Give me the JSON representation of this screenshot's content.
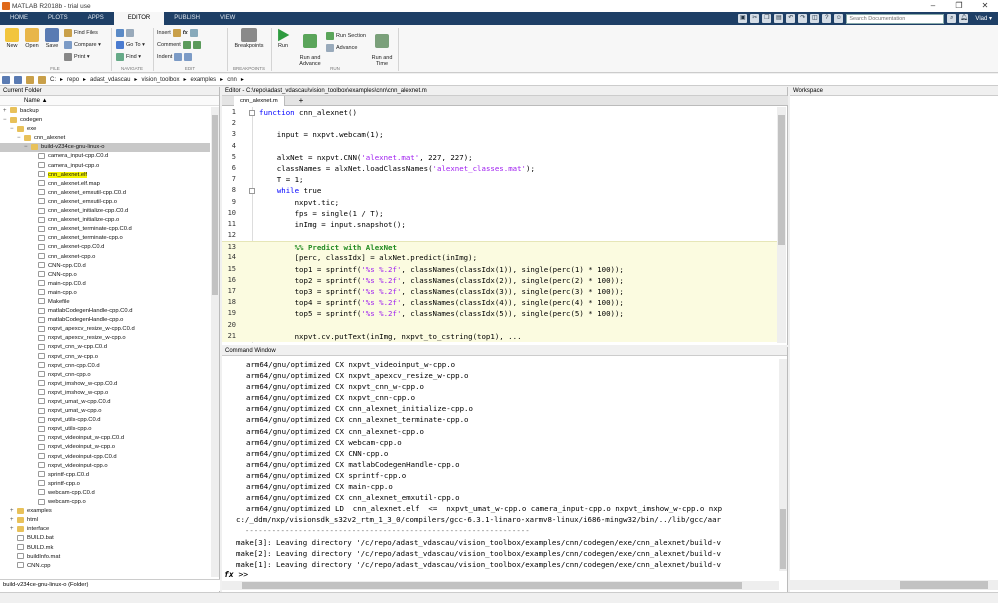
{
  "window": {
    "title": "MATLAB R2018b - trial use",
    "controls": [
      "–",
      "❐",
      "✕"
    ]
  },
  "tabs": [
    "HOME",
    "PLOTS",
    "APPS",
    "EDITOR",
    "PUBLISH",
    "VIEW"
  ],
  "active_tab": "EDITOR",
  "search": {
    "placeholder": "Search Documentation"
  },
  "user": "Vlad ▾",
  "ribbon": {
    "file": {
      "new": "New",
      "open": "Open",
      "save": "Save",
      "find_files": "Find Files",
      "compare": "Compare ▾",
      "print": "Print ▾",
      "section": "FILE"
    },
    "navigate": {
      "go_to": "Go To ▾",
      "find": "Find ▾",
      "section": "NAVIGATE"
    },
    "edit": {
      "insert": "Insert",
      "comment": "Comment",
      "indent": "Indent",
      "fx": "fx",
      "section": "EDIT"
    },
    "breakpoints": {
      "label": "Breakpoints",
      "section": "BREAKPOINTS"
    },
    "run": {
      "run": "Run",
      "run_advance": "Run and\nAdvance",
      "run_section": "Run Section",
      "advance": "Advance",
      "run_time": "Run and\nTime",
      "section": "RUN"
    }
  },
  "address": {
    "parts": [
      "C:",
      "repo",
      "adast_vdascau",
      "vision_toolbox",
      "examples",
      "cnn"
    ]
  },
  "current_folder": {
    "title": "Current Folder",
    "col_name": "Name ▲",
    "items": [
      {
        "label": "backup",
        "type": "folder",
        "level": 1,
        "exp": "+"
      },
      {
        "label": "codegen",
        "type": "folder",
        "level": 1,
        "exp": "−"
      },
      {
        "label": "exe",
        "type": "folder",
        "level": 2,
        "exp": "−"
      },
      {
        "label": "cnn_alexnet",
        "type": "folder",
        "level": 3,
        "exp": "−"
      },
      {
        "label": "build-v234ce-gnu-linux-o",
        "type": "folder",
        "level": 4,
        "exp": "−",
        "selected": true
      },
      {
        "label": "camera_input-cpp.C0.d",
        "type": "file",
        "level": 5
      },
      {
        "label": "camera_input-cpp.o",
        "type": "file",
        "level": 5
      },
      {
        "label": "cnn_alexnet.elf",
        "type": "file",
        "level": 5,
        "highlight": true
      },
      {
        "label": "cnn_alexnet.elf.map",
        "type": "file",
        "level": 5
      },
      {
        "label": "cnn_alexnet_emxutil-cpp.C0.d",
        "type": "file",
        "level": 5
      },
      {
        "label": "cnn_alexnet_emxutil-cpp.o",
        "type": "file",
        "level": 5
      },
      {
        "label": "cnn_alexnet_initialize-cpp.C0.d",
        "type": "file",
        "level": 5
      },
      {
        "label": "cnn_alexnet_initialize-cpp.o",
        "type": "file",
        "level": 5
      },
      {
        "label": "cnn_alexnet_terminate-cpp.C0.d",
        "type": "file",
        "level": 5
      },
      {
        "label": "cnn_alexnet_terminate-cpp.o",
        "type": "file",
        "level": 5
      },
      {
        "label": "cnn_alexnet-cpp.C0.d",
        "type": "file",
        "level": 5
      },
      {
        "label": "cnn_alexnet-cpp.o",
        "type": "file",
        "level": 5
      },
      {
        "label": "CNN-cpp.C0.d",
        "type": "file",
        "level": 5
      },
      {
        "label": "CNN-cpp.o",
        "type": "file",
        "level": 5
      },
      {
        "label": "main-cpp.C0.d",
        "type": "file",
        "level": 5
      },
      {
        "label": "main-cpp.o",
        "type": "file",
        "level": 5
      },
      {
        "label": "Makefile",
        "type": "file",
        "level": 5
      },
      {
        "label": "matlabCodegenHandle-cpp.C0.d",
        "type": "file",
        "level": 5
      },
      {
        "label": "matlabCodegenHandle-cpp.o",
        "type": "file",
        "level": 5
      },
      {
        "label": "nxpvt_apexcv_resize_w-cpp.C0.d",
        "type": "file",
        "level": 5
      },
      {
        "label": "nxpvt_apexcv_resize_w-cpp.o",
        "type": "file",
        "level": 5
      },
      {
        "label": "nxpvt_cnn_w-cpp.C0.d",
        "type": "file",
        "level": 5
      },
      {
        "label": "nxpvt_cnn_w-cpp.o",
        "type": "file",
        "level": 5
      },
      {
        "label": "nxpvt_cnn-cpp.C0.d",
        "type": "file",
        "level": 5
      },
      {
        "label": "nxpvt_cnn-cpp.o",
        "type": "file",
        "level": 5
      },
      {
        "label": "nxpvt_imshow_w-cpp.C0.d",
        "type": "file",
        "level": 5
      },
      {
        "label": "nxpvt_imshow_w-cpp.o",
        "type": "file",
        "level": 5
      },
      {
        "label": "nxpvt_umat_w-cpp.C0.d",
        "type": "file",
        "level": 5
      },
      {
        "label": "nxpvt_umat_w-cpp.o",
        "type": "file",
        "level": 5
      },
      {
        "label": "nxpvt_utils-cpp.C0.d",
        "type": "file",
        "level": 5
      },
      {
        "label": "nxpvt_utils-cpp.o",
        "type": "file",
        "level": 5
      },
      {
        "label": "nxpvt_videoinput_w-cpp.C0.d",
        "type": "file",
        "level": 5
      },
      {
        "label": "nxpvt_videoinput_w-cpp.o",
        "type": "file",
        "level": 5
      },
      {
        "label": "nxpvt_videoinput-cpp.C0.d",
        "type": "file",
        "level": 5
      },
      {
        "label": "nxpvt_videoinput-cpp.o",
        "type": "file",
        "level": 5
      },
      {
        "label": "sprintf-cpp.C0.d",
        "type": "file",
        "level": 5
      },
      {
        "label": "sprintf-cpp.o",
        "type": "file",
        "level": 5
      },
      {
        "label": "webcam-cpp.C0.d",
        "type": "file",
        "level": 5
      },
      {
        "label": "webcam-cpp.o",
        "type": "file",
        "level": 5
      },
      {
        "label": "examples",
        "type": "folder",
        "level": 2,
        "exp": "+"
      },
      {
        "label": "html",
        "type": "folder",
        "level": 2,
        "exp": "+"
      },
      {
        "label": "interface",
        "type": "folder",
        "level": 2,
        "exp": "+"
      },
      {
        "label": "BUILD.bat",
        "type": "file",
        "level": 2
      },
      {
        "label": "BUILD.mk",
        "type": "file",
        "level": 2
      },
      {
        "label": "buildInfo.mat",
        "type": "file",
        "level": 2
      },
      {
        "label": "CNN.cpp",
        "type": "file",
        "level": 2
      }
    ],
    "status": "build-v234ce-gnu-linux-o (Folder)"
  },
  "editor": {
    "title": "Editor - C:\\repo\\adast_vdascau\\vision_toolbox\\examples\\cnn\\cnn_alexnet.m",
    "tab": "cnn_alexnet.m",
    "lines": [
      {
        "n": "1",
        "html": "<span class=\"kw\">function</span> cnn_alexnet()"
      },
      {
        "n": "2",
        "html": ""
      },
      {
        "n": "3",
        "html": "    input = nxpvt.webcam(1);"
      },
      {
        "n": "4",
        "html": ""
      },
      {
        "n": "5",
        "html": "    alxNet = nxpvt.CNN(<span class=\"str\">'alexnet.mat'</span>, 227, 227);"
      },
      {
        "n": "6",
        "html": "    classNames = alxNet.loadClassNames(<span class=\"str\">'alexnet_classes.mat'</span>);"
      },
      {
        "n": "7",
        "html": "    T = 1;"
      },
      {
        "n": "8",
        "html": "    <span class=\"kw\">while</span> true"
      },
      {
        "n": "9",
        "html": "        nxpvt.tic;"
      },
      {
        "n": "10",
        "html": "        fps = single(1 / T);"
      },
      {
        "n": "11",
        "html": "        inImg = input.snapshot();"
      },
      {
        "n": "12",
        "html": ""
      },
      {
        "n": "13",
        "html": "        <span class=\"cmt\">%% Predict with AlexNet</span>",
        "cell": true
      },
      {
        "n": "14",
        "html": "        [perc, classIdx] = alxNet.predict(inImg);",
        "cell": true
      },
      {
        "n": "15",
        "html": "        top1 = sprintf(<span class=\"str\">'%s %.2f'</span>, classNames(classIdx(1)), single(perc(1) * 100));",
        "cell": true
      },
      {
        "n": "16",
        "html": "        top2 = sprintf(<span class=\"str\">'%s %.2f'</span>, classNames(classIdx(2)), single(perc(2) * 100));",
        "cell": true
      },
      {
        "n": "17",
        "html": "        top3 = sprintf(<span class=\"str\">'%s %.2f'</span>, classNames(classIdx(3)), single(perc(3) * 100));",
        "cell": true
      },
      {
        "n": "18",
        "html": "        top4 = sprintf(<span class=\"str\">'%s %.2f'</span>, classNames(classIdx(4)), single(perc(4) * 100));",
        "cell": true
      },
      {
        "n": "19",
        "html": "        top5 = sprintf(<span class=\"str\">'%s %.2f'</span>, classNames(classIdx(5)), single(perc(5) * 100));",
        "cell": true
      },
      {
        "n": "20",
        "html": "",
        "cell": true
      },
      {
        "n": "21",
        "html": "        nxpvt.cv.putText(inImg, nxpvt_to_cstring(top1), ...",
        "cell": true
      }
    ]
  },
  "command_window": {
    "title": "Command Window",
    "lines": [
      {
        "t": "arm64/gnu/optimized CX nxpvt_videoinput_w-cpp.o",
        "ind": true
      },
      {
        "t": "arm64/gnu/optimized CX nxpvt_apexcv_resize_w-cpp.o",
        "ind": true
      },
      {
        "t": "arm64/gnu/optimized CX nxpvt_cnn_w-cpp.o",
        "ind": true
      },
      {
        "t": "arm64/gnu/optimized CX nxpvt_cnn-cpp.o",
        "ind": true
      },
      {
        "t": "arm64/gnu/optimized CX cnn_alexnet_initialize-cpp.o",
        "ind": true
      },
      {
        "t": "arm64/gnu/optimized CX cnn_alexnet_terminate-cpp.o",
        "ind": true
      },
      {
        "t": "arm64/gnu/optimized CX cnn_alexnet-cpp.o",
        "ind": true
      },
      {
        "t": "arm64/gnu/optimized CX webcam-cpp.o",
        "ind": true
      },
      {
        "t": "arm64/gnu/optimized CX CNN-cpp.o",
        "ind": true
      },
      {
        "t": "arm64/gnu/optimized CX matlabCodegenHandle-cpp.o",
        "ind": true
      },
      {
        "t": "arm64/gnu/optimized CX sprintf-cpp.o",
        "ind": true
      },
      {
        "t": "arm64/gnu/optimized CX main-cpp.o",
        "ind": true
      },
      {
        "t": "arm64/gnu/optimized CX cnn_alexnet_emxutil-cpp.o",
        "ind": true
      },
      {
        "t": "arm64/gnu/optimized LD  cnn_alexnet.elf  <=  nxpvt_umat_w-cpp.o camera_input-cpp.o nxpvt_imshow_w-cpp.o nxp",
        "ind": true
      },
      {
        "t": "c:/_ddm/nxp/visionsdk_s32v2_rtm_1_3_0/compilers/gcc-6.3.1-linaro-xarmv8-linux/i686-mingw32/bin/../lib/gcc/aar",
        "ind": false
      },
      {
        "t": "  ----------------------------------------------------------------",
        "ind": false,
        "sep": true
      },
      {
        "t": "make[3]: Leaving directory '/c/repo/adast_vdascau/vision_toolbox/examples/cnn/codegen/exe/cnn_alexnet/build-v",
        "ind": false
      },
      {
        "t": "make[2]: Leaving directory '/c/repo/adast_vdascau/vision_toolbox/examples/cnn/codegen/exe/cnn_alexnet/build-v",
        "ind": false
      },
      {
        "t": "make[1]: Leaving directory '/c/repo/adast_vdascau/vision_toolbox/examples/cnn/codegen/exe/cnn_alexnet/build-v",
        "ind": false
      }
    ],
    "prompt_fx": "fx",
    "prompt": ">>"
  },
  "workspace": {
    "title": "Workspace"
  },
  "colors": {
    "tabbar": "#1e3f66",
    "selection": "#c8c8c8",
    "highlight": "#f4f400",
    "cell": "#fbfbe0"
  }
}
